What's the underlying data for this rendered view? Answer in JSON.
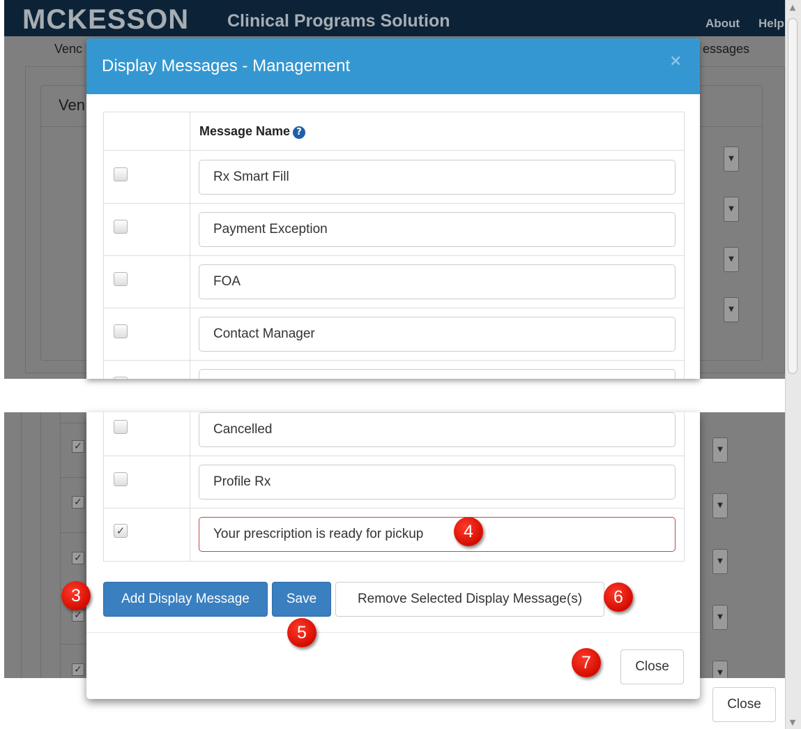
{
  "app": {
    "logo": "MCKESSON",
    "title": "Clinical Programs Solution",
    "links": [
      "About",
      "Help"
    ],
    "subnav_left": "Venc",
    "subnav_right": "essages",
    "panel_heading": "Ven"
  },
  "modal": {
    "title": "Display Messages - Management",
    "close_x": "×",
    "column_header": "Message Name",
    "help_icon": "?",
    "rows_top": [
      {
        "checked": false,
        "value": "Rx Smart Fill"
      },
      {
        "checked": false,
        "value": "Payment Exception"
      },
      {
        "checked": false,
        "value": "FOA"
      },
      {
        "checked": false,
        "value": "Contact Manager"
      }
    ],
    "rows_bottom": [
      {
        "checked": false,
        "value": "Cancelled"
      },
      {
        "checked": false,
        "value": "Profile Rx"
      },
      {
        "checked": true,
        "value": "Your prescription is ready for pickup",
        "error": true
      }
    ],
    "buttons": {
      "add": "Add Display Message",
      "save": "Save",
      "remove": "Remove Selected Display Message(s)",
      "close": "Close"
    }
  },
  "callouts": {
    "add": "3",
    "input": "4",
    "save": "5",
    "remove": "6",
    "close": "7"
  },
  "page_close": "Close",
  "check_glyph": "✓",
  "colors": {
    "modal_header": "#3497d1",
    "primary_button": "#3a7fbf",
    "callout": "#e01b0d",
    "error_border": "#b94a48"
  }
}
